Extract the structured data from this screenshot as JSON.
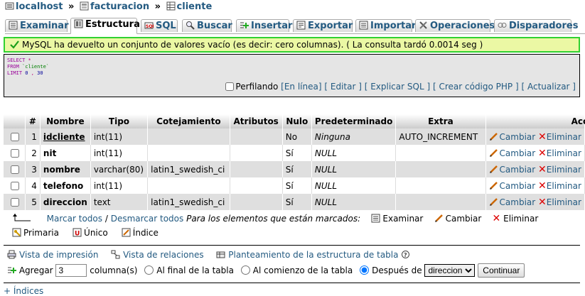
{
  "breadcrumb": {
    "server": "localhost",
    "database": "facturacion",
    "table": "cliente",
    "sep": "»"
  },
  "tabs": [
    {
      "label": "Examinar",
      "icon": "browse-icon"
    },
    {
      "label": "Estructura",
      "icon": "structure-icon",
      "active": true
    },
    {
      "label": "SQL",
      "icon": "sql-icon"
    },
    {
      "label": "Buscar",
      "icon": "search-icon"
    },
    {
      "label": "Insertar",
      "icon": "insert-icon"
    },
    {
      "label": "Exportar",
      "icon": "export-icon"
    },
    {
      "label": "Importar",
      "icon": "import-icon"
    },
    {
      "label": "Operaciones",
      "icon": "operations-icon"
    },
    {
      "label": "Disparadores",
      "icon": "triggers-icon"
    }
  ],
  "message": "MySQL ha devuelto un conjunto de valores vacío (es decir: cero columnas). ( La consulta tardó 0.0014 seg )",
  "sql": {
    "line1_kw": "SELECT",
    "line1_rest": "*",
    "line2_kw": "FROM",
    "line2_rest": "`cliente`",
    "line3_kw": "LIMIT",
    "line3_a": "0",
    "line3_comma": ",",
    "line3_b": "30"
  },
  "sql_tools": {
    "profiling": "Perfilando",
    "inline": "[En línea]",
    "edit": "[ Editar ]",
    "explain": "[ Explicar SQL ]",
    "php": "[ Crear código PHP ]",
    "refresh": "[ Actualizar ]"
  },
  "table": {
    "headers": [
      "#",
      "Nombre",
      "Tipo",
      "Cotejamiento",
      "Atributos",
      "Nulo",
      "Predeterminado",
      "Extra",
      "Acción"
    ],
    "rows": [
      {
        "num": "1",
        "name": "idcliente",
        "type": "int(11)",
        "collation": "",
        "attributes": "",
        "null": "No",
        "default": "Ninguna",
        "extra": "AUTO_INCREMENT"
      },
      {
        "num": "2",
        "name": "nit",
        "type": "int(11)",
        "collation": "",
        "attributes": "",
        "null": "Sí",
        "default": "NULL",
        "extra": ""
      },
      {
        "num": "3",
        "name": "nombre",
        "type": "varchar(80)",
        "collation": "latin1_swedish_ci",
        "attributes": "",
        "null": "Sí",
        "default": "NULL",
        "extra": ""
      },
      {
        "num": "4",
        "name": "telefono",
        "type": "int(11)",
        "collation": "",
        "attributes": "",
        "null": "Sí",
        "default": "NULL",
        "extra": ""
      },
      {
        "num": "5",
        "name": "direccion",
        "type": "text",
        "collation": "latin1_swedish_ci",
        "attributes": "",
        "null": "Sí",
        "default": "NULL",
        "extra": ""
      }
    ],
    "change_label": "Cambiar",
    "drop_label": "Eliminar"
  },
  "marked": {
    "check_all": "Marcar todos",
    "slash": "/",
    "uncheck_all": "Desmarcar todos",
    "text": "Para los elementos que están marcados:",
    "browse": "Examinar",
    "change": "Cambiar",
    "drop": "Eliminar",
    "primary": "Primaria",
    "unique": "Único",
    "index": "Índice"
  },
  "links": {
    "print": "Vista de impresión",
    "relations": "Vista de relaciones",
    "propose": "Planteamiento de la estructura de tabla"
  },
  "add": {
    "label": "Agregar",
    "count": "3",
    "columns": "columna(s)",
    "end": "Al final de la tabla",
    "begin": "Al comienzo de la tabla",
    "after": "Después de",
    "after_value": "direccion",
    "go": "Continuar"
  },
  "indices_link": "+ Índices",
  "colors": {
    "link": "#235a81",
    "success_border": "#31d131",
    "success_bg": "#ebf8a4",
    "delete": "#dd0000"
  }
}
